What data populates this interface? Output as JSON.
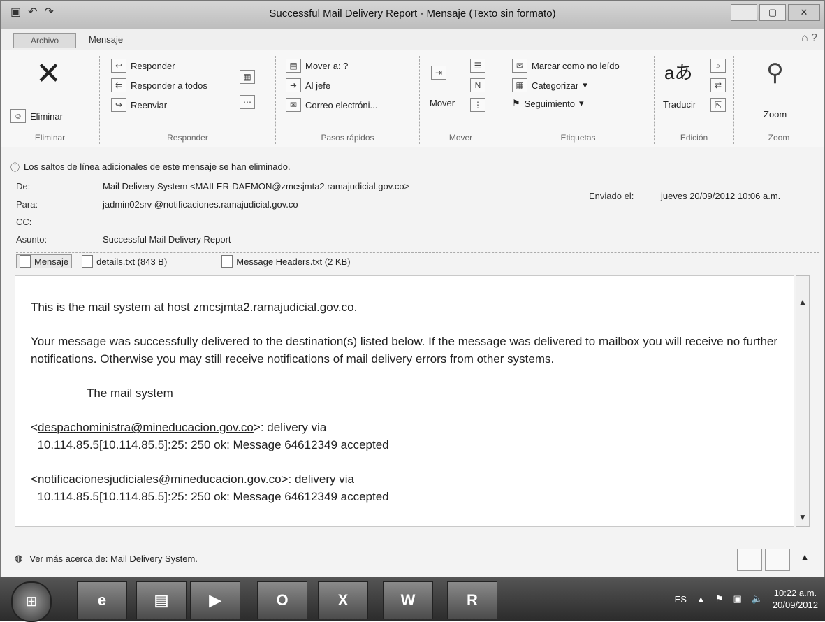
{
  "window": {
    "title": "Successful Mail Delivery Report - Mensaje (Texto sin formato)"
  },
  "tabs": {
    "file": "Archivo",
    "message": "Mensaje"
  },
  "ribbon": {
    "delete": {
      "label": "Eliminar",
      "group": "Eliminar"
    },
    "respond": {
      "reply": "Responder",
      "reply_all": "Responder a todos",
      "forward": "Reenviar",
      "group": "Responder"
    },
    "quicksteps": {
      "move_to": "Mover a: ?",
      "to_boss": "Al jefe",
      "email": "Correo electróni...",
      "group": "Pasos rápidos"
    },
    "move": {
      "label": "Mover",
      "group": "Mover"
    },
    "tags": {
      "mark_unread": "Marcar como no leído",
      "categorize": "Categorizar",
      "followup": "Seguimiento",
      "group": "Etiquetas"
    },
    "edit": {
      "translate": "Traducir",
      "group": "Edición"
    },
    "zoom": {
      "label": "Zoom",
      "group": "Zoom"
    }
  },
  "infobar": "Los saltos de línea adicionales de este mensaje se han eliminado.",
  "header": {
    "from_label": "De:",
    "from": "Mail Delivery System <MAILER-DAEMON@zmcsjmta2.ramajudicial.gov.co>",
    "to_label": "Para:",
    "to": "jadmin02srv @notificaciones.ramajudicial.gov.co",
    "cc_label": "CC:",
    "subject_label": "Asunto:",
    "subject": "Successful Mail Delivery Report",
    "sent_label": "Enviado el:",
    "sent": "jueves 20/09/2012 10:06 a.m."
  },
  "attachments": [
    "Mensaje",
    "details.txt (843 B)",
    "Message Headers.txt (2 KB)"
  ],
  "body": {
    "line1": "This is the mail system at host zmcsjmta2.ramajudicial.gov.co.",
    "para2": "Your message was successfully delivered to the destination(s) listed below. If the message was delivered to mailbox you will receive no further notifications. Otherwise you may still receive notifications of mail delivery errors from other systems.",
    "signature": "The mail system",
    "r1_addr": "despachoministra@mineducacion.gov.co",
    "r1_via": ">: delivery via",
    "r1_detail": "10.114.85.5[10.114.85.5]:25: 250 ok:  Message 64612349 accepted",
    "r2_addr": "notificacionesjudiciales@mineducacion.gov.co",
    "r2_via": ">: delivery via",
    "r2_detail": "10.114.85.5[10.114.85.5]:25: 250 ok:  Message 64612349 accepted"
  },
  "people": "Ver más acerca de: Mail Delivery System.",
  "taskbar": {
    "lang": "ES",
    "time": "10:22 a.m.",
    "date": "20/09/2012"
  }
}
